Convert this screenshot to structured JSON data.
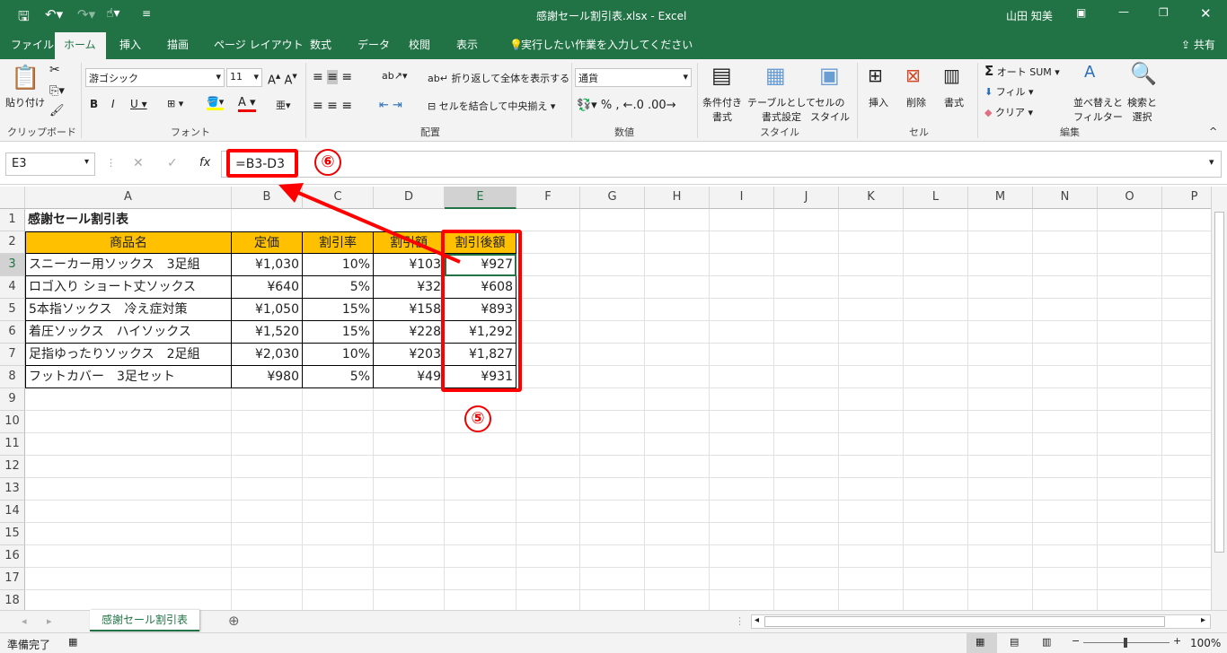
{
  "title": "感謝セール割引表.xlsx  -  Excel",
  "user": "山田 知美",
  "tabs": [
    "ファイル",
    "ホーム",
    "挿入",
    "描画",
    "ページ レイアウト",
    "数式",
    "データ",
    "校閲",
    "表示"
  ],
  "tell_me": "実行したい作業を入力してください",
  "share": "共有",
  "ribbon": {
    "paste": "貼り付け",
    "clipboard": "クリップボード",
    "font_name": "游ゴシック",
    "font_size": "11",
    "font": "フォント",
    "wrap": "折り返して全体を表示する",
    "merge": "セルを結合して中央揃え",
    "alignment": "配置",
    "number_format": "通貨",
    "number": "数値",
    "cond": "条件付き\n書式",
    "table": "テーブルとして\n書式設定",
    "cellstyle": "セルの\nスタイル",
    "styles": "スタイル",
    "insert": "挿入",
    "delete": "削除",
    "format": "書式",
    "cells": "セル",
    "autosum": "オート SUM",
    "fill": "フィル",
    "clear": "クリア",
    "sort": "並べ替えと\nフィルター",
    "find": "検索と\n選択",
    "editing": "編集"
  },
  "namebox": "E3",
  "formula": "=B3-D3",
  "columns": [
    "A",
    "B",
    "C",
    "D",
    "E",
    "F",
    "G",
    "H",
    "I",
    "J",
    "K",
    "L",
    "M",
    "N",
    "O",
    "P"
  ],
  "rows": [
    [
      "感謝セール割引表",
      "",
      "",
      "",
      ""
    ],
    [
      "商品名",
      "定価",
      "割引率",
      "割引額",
      "割引後額"
    ],
    [
      "スニーカー用ソックス　3足組",
      "¥1,030",
      "10%",
      "¥103",
      "¥927"
    ],
    [
      "ロゴ入り ショート丈ソックス",
      "¥640",
      "5%",
      "¥32",
      "¥608"
    ],
    [
      "5本指ソックス　冷え症対策",
      "¥1,050",
      "15%",
      "¥158",
      "¥893"
    ],
    [
      "着圧ソックス　ハイソックス",
      "¥1,520",
      "15%",
      "¥228",
      "¥1,292"
    ],
    [
      "足指ゆったりソックス　2足組",
      "¥2,030",
      "10%",
      "¥203",
      "¥1,827"
    ],
    [
      "フットカバー　3足セット",
      "¥980",
      "5%",
      "¥49",
      "¥931"
    ]
  ],
  "row_count": 18,
  "annotations": {
    "five": "⑤",
    "six": "⑥"
  },
  "sheet_tab": "感謝セール割引表",
  "status": "準備完了",
  "zoom": "100%",
  "colors": {
    "green": "#217346",
    "header_fill": "#ffc000",
    "annotation": "#ff0000"
  }
}
